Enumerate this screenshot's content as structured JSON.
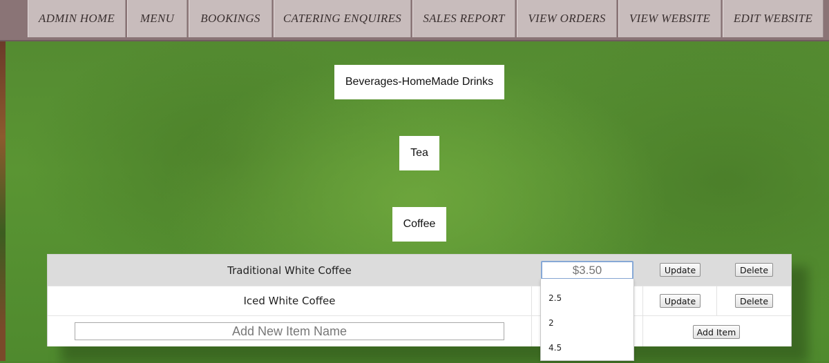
{
  "nav": [
    {
      "label": "ADMIN HOME"
    },
    {
      "label": "MENU"
    },
    {
      "label": "BOOKINGS"
    },
    {
      "label": "CATERING ENQUIRES"
    },
    {
      "label": "SALES REPORT"
    },
    {
      "label": "VIEW ORDERS"
    },
    {
      "label": "VIEW WEBSITE"
    },
    {
      "label": "EDIT WEBSITE"
    }
  ],
  "categories": [
    {
      "label": "Beverages-HomeMade Drinks"
    },
    {
      "label": "Tea"
    },
    {
      "label": "Coffee"
    }
  ],
  "items": [
    {
      "name": "Traditional White Coffee",
      "price": "$3.50",
      "update_label": "Update",
      "delete_label": "Delete"
    },
    {
      "name": "Iced White Coffee",
      "update_label": "Update",
      "delete_label": "Delete"
    }
  ],
  "new_item": {
    "placeholder": "Add New Item Name",
    "add_label": "Add Item"
  },
  "price_suggestions": [
    "2.5",
    "2",
    "4.5"
  ]
}
